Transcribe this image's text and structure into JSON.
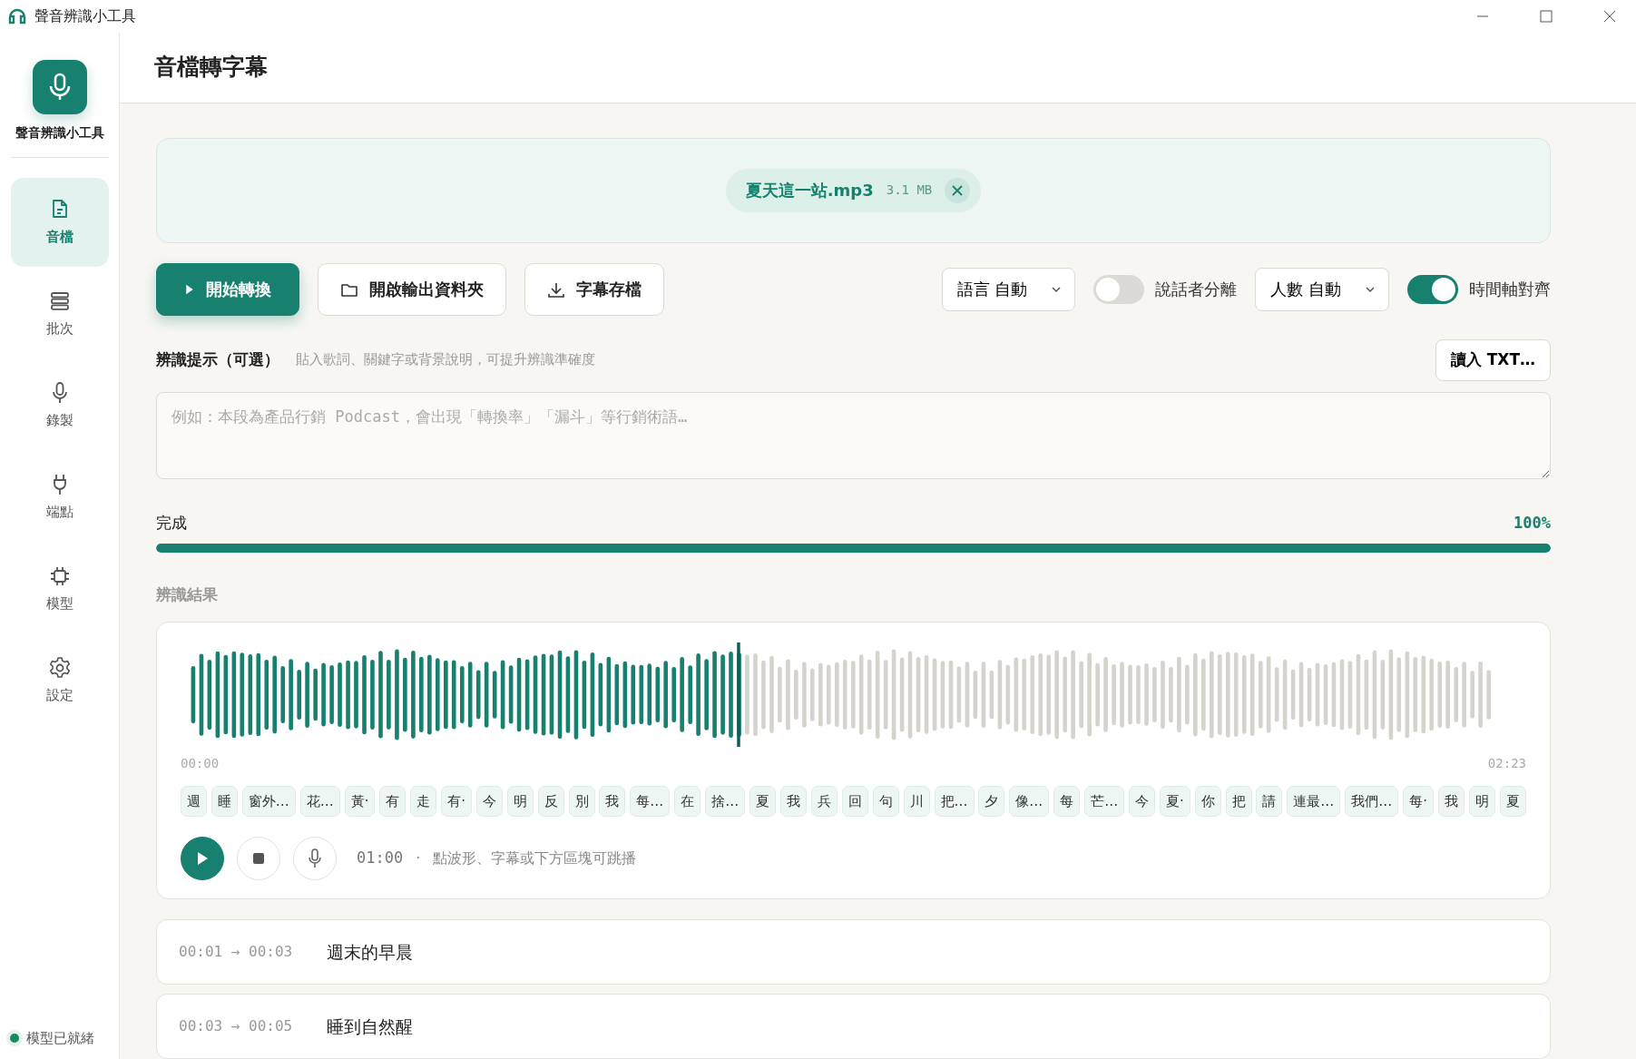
{
  "window": {
    "title": "聲音辨識小工具"
  },
  "sidebar": {
    "app_name": "聲音辨識小工具",
    "items": [
      {
        "label": "音檔",
        "selected": true
      },
      {
        "label": "批次",
        "selected": false
      },
      {
        "label": "錄製",
        "selected": false
      },
      {
        "label": "端點",
        "selected": false
      },
      {
        "label": "模型",
        "selected": false
      },
      {
        "label": "設定",
        "selected": false
      }
    ],
    "status": {
      "text": "模型已就緒",
      "ready": true
    }
  },
  "page_title": "音檔轉字幕",
  "file": {
    "name": "夏天這一站.mp3",
    "size": "3.1 MB"
  },
  "actions": [
    {
      "label": "開始轉換",
      "kind": "primary"
    },
    {
      "label": "開啟輸出資料夾",
      "kind": "folder"
    },
    {
      "label": "字幕存檔",
      "kind": "download"
    }
  ],
  "options": [
    {
      "kind": "select",
      "label": "語言 自動"
    },
    {
      "kind": "toggle",
      "label": "說話者分離",
      "on": false
    },
    {
      "kind": "select",
      "label": "人數 自動"
    },
    {
      "kind": "toggle",
      "label": "時間軸對齊",
      "on": true
    }
  ],
  "hint": {
    "title": "辨識提示（可選）",
    "description": "貼入歌詞、關鍵字或背景說明，可提升辨識準確度",
    "load_button": "讀入 TXT…",
    "placeholder": "例如：本段為產品行銷 Podcast，會出現「轉換率」「漏斗」等行銷術語…"
  },
  "progress": {
    "label": "完成",
    "value": "100%",
    "level": 1
  },
  "results": {
    "title": "辨識結果",
    "waveform": {
      "level": 0.42,
      "start": "00:00",
      "end": "02:23"
    },
    "chips": [
      "週",
      "睡",
      "窗外…",
      "花…",
      "黃·",
      "有",
      "走",
      "有·",
      "今",
      "明",
      "反",
      "別",
      "我",
      "每…",
      "在",
      "捨…",
      "夏",
      "我",
      "兵",
      "回",
      "句",
      "川",
      "把…",
      "夕",
      "像…",
      "每",
      "芒…",
      "今",
      "夏·",
      "你",
      "把",
      "請",
      "連最…",
      "我們…",
      "每·",
      "我",
      "明",
      "夏"
    ],
    "player": {
      "time": "01:00",
      "separator": "·",
      "help": "點波形、字幕或下方區塊可跳播"
    }
  },
  "segments": [
    {
      "time": "00:01 → 00:03",
      "text": "週末的早晨"
    },
    {
      "time": "00:03 → 00:05",
      "text": "睡到自然醒"
    }
  ]
}
